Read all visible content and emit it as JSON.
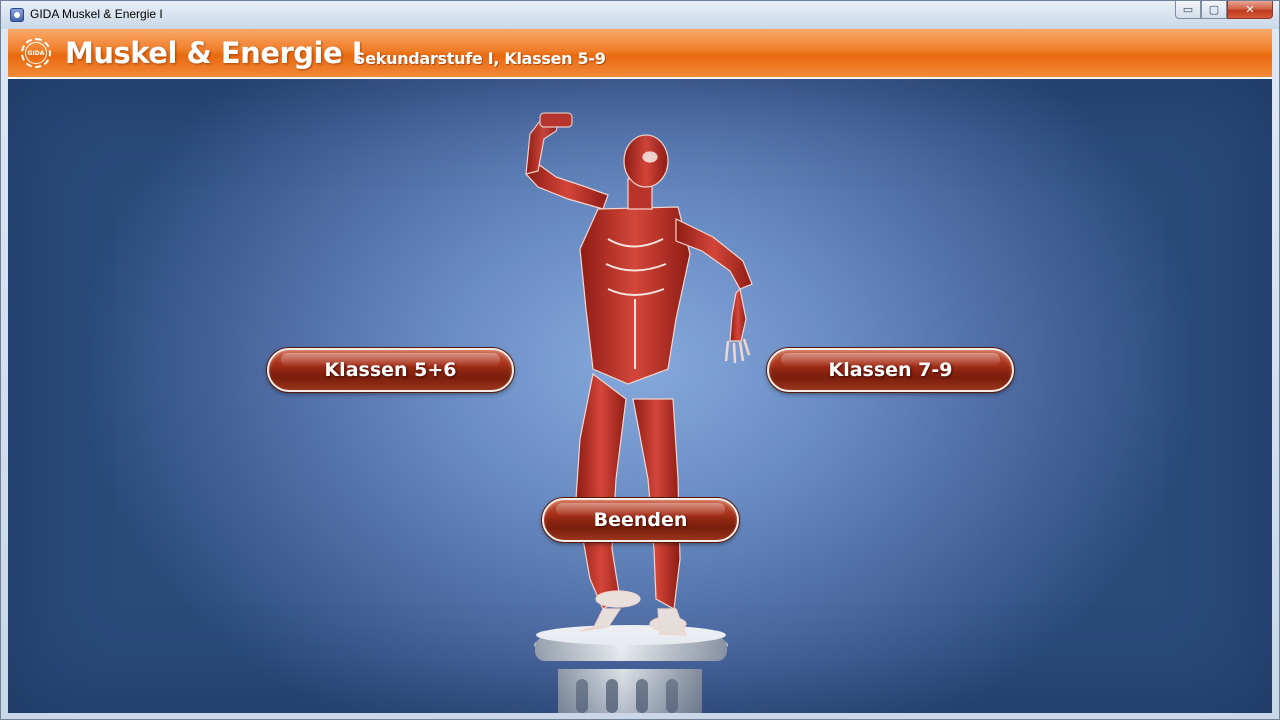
{
  "window": {
    "title": "GIDA Muskel & Energie I",
    "minimize_label": "▭",
    "maximize_label": "▢",
    "close_label": "✕"
  },
  "header": {
    "logo_text": "GIDA",
    "title": "Muskel & Energie I",
    "subtitle": "Sekundarstufe I, Klassen 5-9"
  },
  "menu": {
    "button_left": "Klassen 5+6",
    "button_right": "Klassen 7-9",
    "button_quit": "Beenden"
  },
  "colors": {
    "header_orange": "#f07d28",
    "background_blue": "#6a8cc4",
    "button_red": "#8e2611",
    "muscle_red": "#c8372b"
  }
}
